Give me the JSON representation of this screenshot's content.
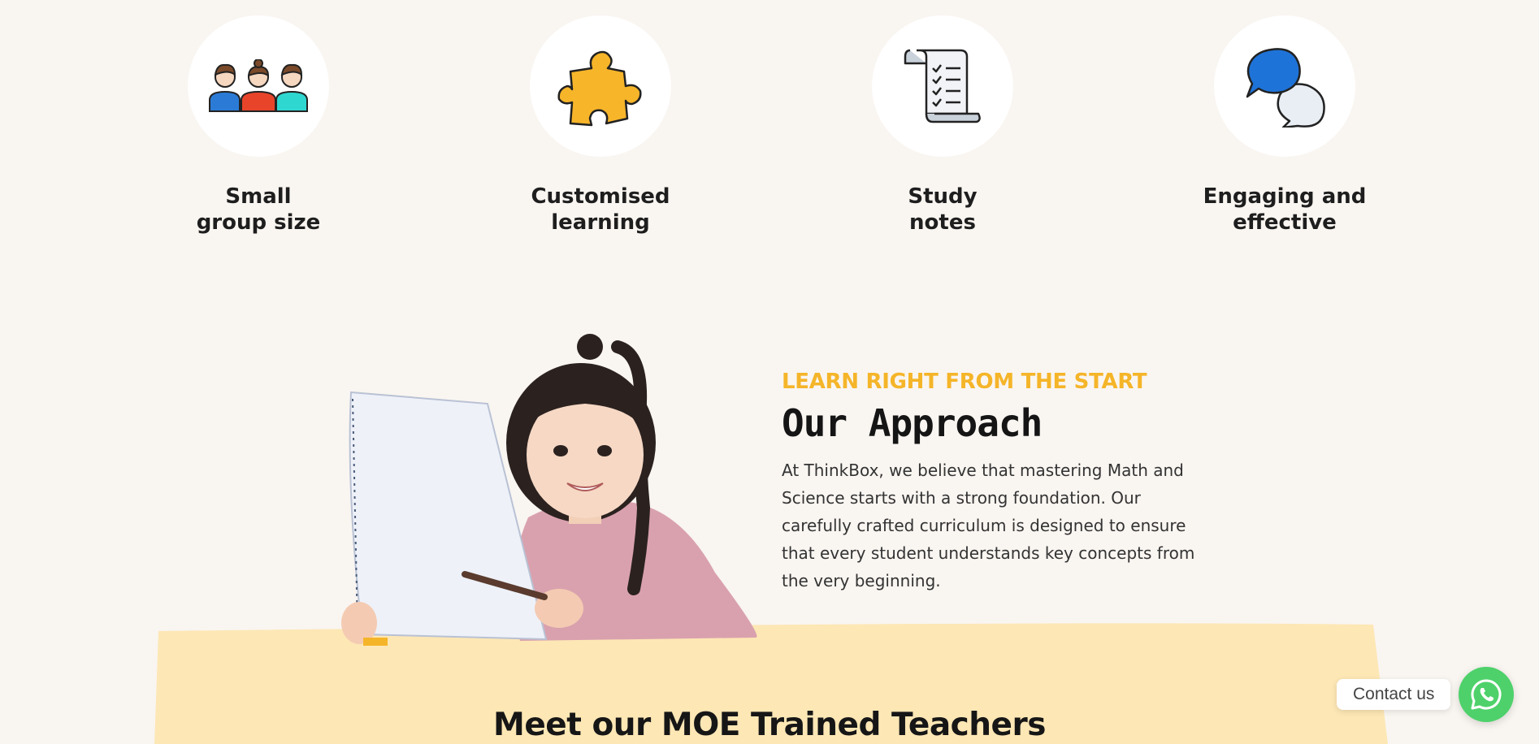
{
  "features": [
    {
      "icon": "group-people-icon",
      "line1": "Small",
      "line2": "group size"
    },
    {
      "icon": "puzzle-piece-icon",
      "line1": "Customised",
      "line2": "learning"
    },
    {
      "icon": "scroll-checklist-icon",
      "line1": "Study",
      "line2": "notes"
    },
    {
      "icon": "chat-bubbles-icon",
      "line1": "Engaging and",
      "line2": "effective"
    }
  ],
  "approach": {
    "eyebrow": "LEARN RIGHT FROM THE START",
    "title": "Our Approach",
    "body": "At ThinkBox, we believe that mastering Math and Science starts with a strong foundation. Our carefully crafted curriculum is designed to ensure that every student understands key concepts from the very beginning."
  },
  "teachers": {
    "title": "Meet our MOE Trained Teachers"
  },
  "contact": {
    "label": "Contact us",
    "icon": "whatsapp-icon"
  },
  "colors": {
    "accent": "#f5b529",
    "band": "#fde7b5",
    "background": "#f9f5f1",
    "whatsapp": "#4ed16b"
  }
}
